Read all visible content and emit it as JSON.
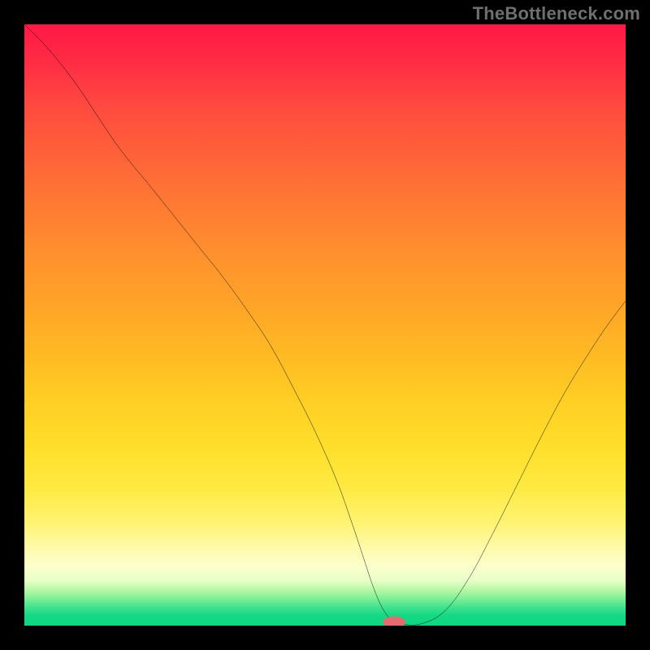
{
  "watermark": "TheBottleneck.com",
  "colors": {
    "frame_bg": "#000000",
    "gradient_top": "#ff1846",
    "gradient_mid": "#ffcd24",
    "gradient_bottom": "#0cd882",
    "curve_stroke": "#000000",
    "marker_fill": "#e86a6f",
    "watermark_text": "#6f6f6f"
  },
  "chart_data": {
    "type": "line",
    "title": "",
    "xlabel": "",
    "ylabel": "",
    "xlim": [
      0,
      100
    ],
    "ylim": [
      0,
      100
    ],
    "x": [
      0,
      3,
      6,
      9,
      12,
      15,
      18,
      21,
      25,
      29,
      33,
      37,
      41,
      45,
      48.5,
      52,
      54.5,
      56.5,
      58,
      59.5,
      61,
      62.5,
      66,
      70,
      74,
      78,
      82,
      86,
      90,
      94,
      97,
      100
    ],
    "values": [
      100,
      97,
      93.5,
      89.5,
      85,
      80.5,
      76.6,
      73,
      68,
      63,
      58,
      52.5,
      46.5,
      39,
      32,
      24,
      17,
      11,
      6.5,
      3,
      1,
      0.3,
      0.3,
      2.5,
      8,
      15.5,
      23.5,
      31.5,
      39,
      45.5,
      50,
      54
    ],
    "marker": {
      "x": 61.5,
      "y": 0.6,
      "rx": 1.9,
      "ry": 0.9,
      "note": "small red lozenge at curve minimum"
    },
    "notes": "V-shaped black curve over vertical rainbow gradient; no axes, ticks, or labels visible"
  }
}
